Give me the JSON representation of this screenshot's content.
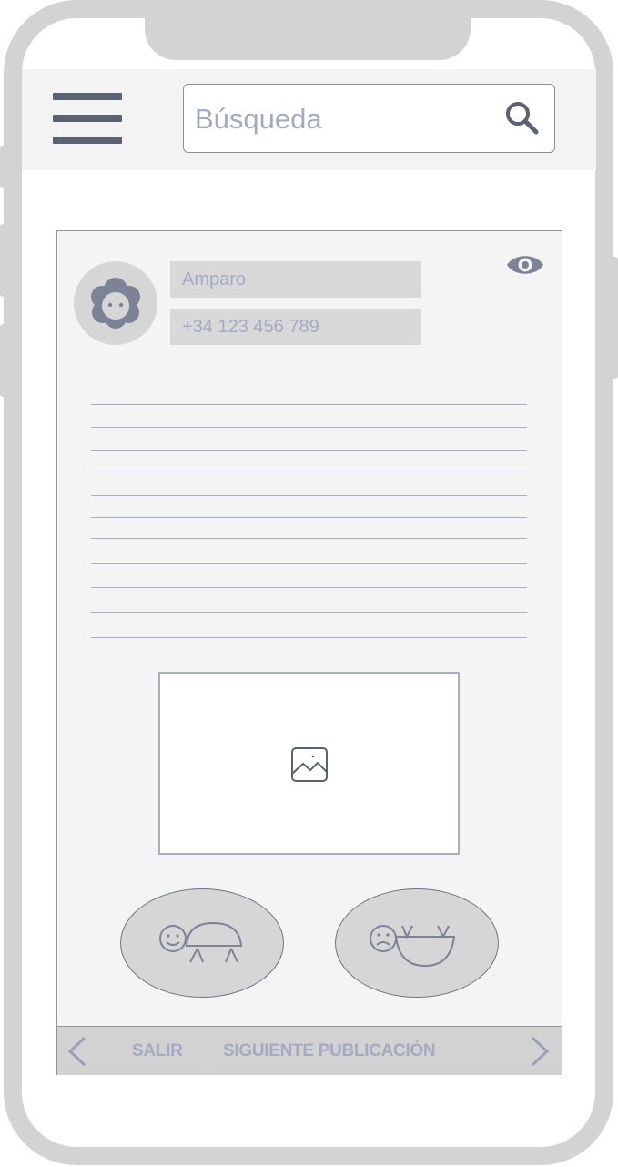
{
  "header": {
    "search": {
      "placeholder": "Búsqueda",
      "value": ""
    }
  },
  "post": {
    "author_name": "Amparo",
    "author_phone": "+34 123 456 789",
    "text_line_count": 11
  },
  "reactions": [
    {
      "name": "happy-turtle"
    },
    {
      "name": "sad-crab"
    }
  ],
  "bottom_bar": {
    "exit_label": "SALIR",
    "next_label": "SIGUIENTE PUBLICACIÓN"
  },
  "colors": {
    "frame": "#d3d3d3",
    "header_bg": "#f3f3f3",
    "icon_dark": "#5b6272",
    "placeholder_text": "#a3abc2",
    "card_bg": "#f4f4f4",
    "bar_bg": "#d2d2d2"
  },
  "icons": {
    "menu": "hamburger-icon",
    "search": "search-icon",
    "avatar": "user-avatar-icon",
    "visibility": "eye-icon",
    "image": "image-icon",
    "back": "chevron-left-icon",
    "next": "chevron-right-icon"
  }
}
